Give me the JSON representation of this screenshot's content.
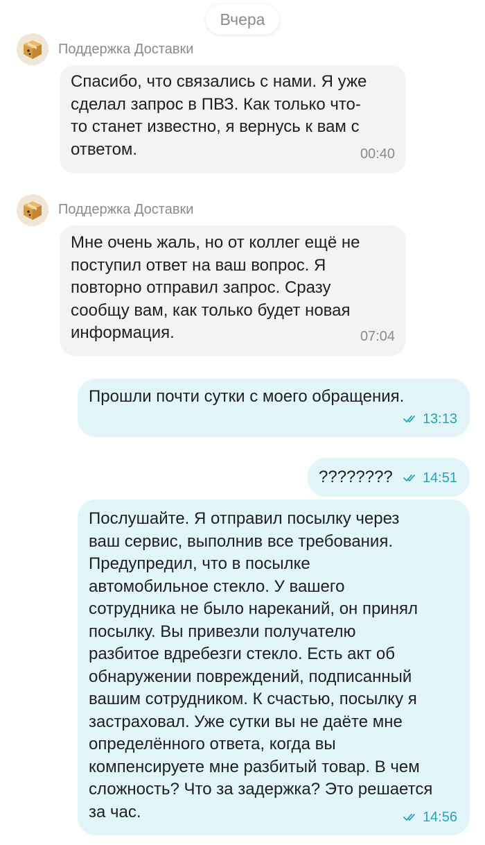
{
  "date_separator": "Вчера",
  "messages": [
    {
      "direction": "in",
      "sender": "Поддержка Доставки",
      "text": "Спасибо, что связались с нами. Я уже\nсделал запрос в ПВЗ. Как только что-\nто станет известно, я вернусь к вам с\nответом.",
      "time": "00:40"
    },
    {
      "direction": "in",
      "sender": "Поддержка Доставки",
      "text": "Мне очень жаль, но от коллег ещё не\nпоступил ответ на ваш вопрос. Я\nповторно отправил запрос. Сразу\nсообщу вам, как только будет новая\nинформация.",
      "time": "07:04"
    },
    {
      "direction": "out",
      "text": "Прошли почти сутки с моего обращения.",
      "time": "13:13",
      "status": "read"
    },
    {
      "direction": "out",
      "text": "????????",
      "time": "14:51",
      "status": "read"
    },
    {
      "direction": "out",
      "text": "Послушайте. Я отправил посылку через\nваш сервис, выполнив все требования.\nПредупредил, что в посылке\nавтомобильное стекло. У вашего\nсотрудника не было нареканий, он принял\nпосылку. Вы привезли получателю\nразбитое вдребезги  стекло. Есть акт об\nобнаружении повреждений, подписанный\nвашим сотрудником. К счастью, посылку я\nзастраховал. Уже сутки вы не даёте мне\nопределённого ответа, когда вы\nкомпенсируете мне разбитый товар. В чем\nсложность? Что за задержка? Это решается\nза час.",
      "time": "14:56",
      "status": "read"
    }
  ],
  "icons": {
    "avatar": "delivery-box-icon",
    "read_status": "double-check-icon"
  },
  "colors": {
    "incoming_bubble": "#f2f3f5",
    "outgoing_bubble": "#e2f5f8",
    "outgoing_meta": "#27a3b8",
    "secondary_text": "#8a8a8f"
  }
}
